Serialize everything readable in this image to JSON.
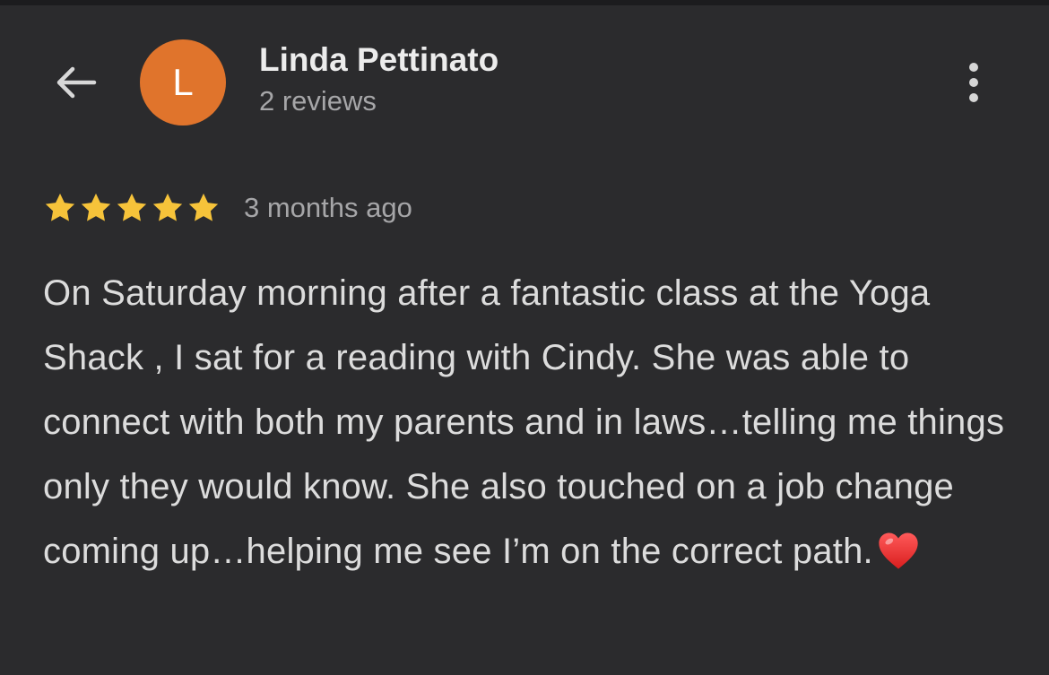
{
  "header": {
    "back_icon": "arrow-left-icon",
    "avatar_initial": "L",
    "avatar_color": "#e0742c",
    "reviewer_name": "Linda Pettinato",
    "review_count": "2 reviews",
    "more_icon": "more-vertical-icon"
  },
  "review": {
    "rating": 5,
    "rating_max": 5,
    "star_color": "#f6c33a",
    "date": "3 months ago",
    "text": "On Saturday morning after a fantastic class at the Yoga Shack , I sat for a reading with Cindy. She was able to connect with both my parents and in laws…telling me things only they would know. She also touched on a job change coming up…helping me see I’m on the correct path.",
    "end_icon": "heart-icon"
  }
}
